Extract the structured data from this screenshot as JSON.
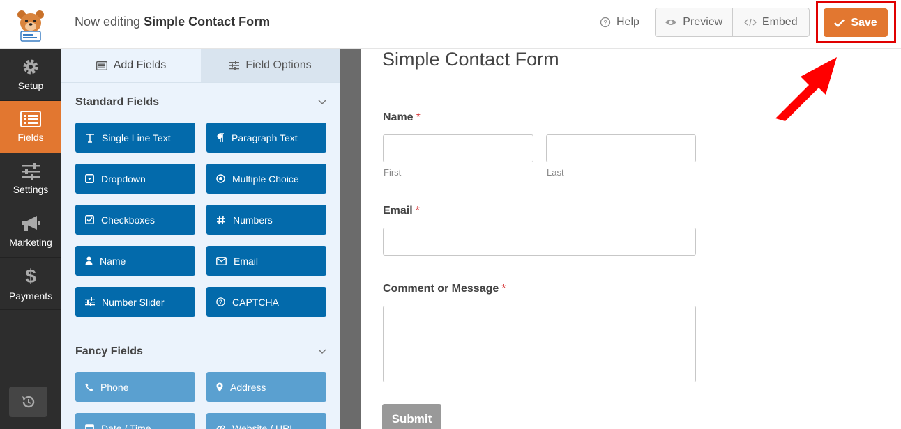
{
  "header": {
    "title_prefix": "Now editing",
    "title_form": "Simple Contact Form",
    "help_label": "Help",
    "preview_label": "Preview",
    "embed_label": "Embed",
    "save_label": "Save"
  },
  "sidebar": {
    "items": [
      {
        "label": "Setup",
        "icon": "gear-icon"
      },
      {
        "label": "Fields",
        "icon": "fields-icon"
      },
      {
        "label": "Settings",
        "icon": "sliders-icon"
      },
      {
        "label": "Marketing",
        "icon": "megaphone-icon"
      },
      {
        "label": "Payments",
        "icon": "dollar-icon"
      }
    ]
  },
  "panel": {
    "tabs": [
      {
        "label": "Add Fields"
      },
      {
        "label": "Field Options"
      }
    ],
    "standard_title": "Standard Fields",
    "standard_fields": [
      {
        "label": "Single Line Text",
        "icon": "text-icon"
      },
      {
        "label": "Paragraph Text",
        "icon": "paragraph-icon"
      },
      {
        "label": "Dropdown",
        "icon": "dropdown-icon"
      },
      {
        "label": "Multiple Choice",
        "icon": "radio-icon"
      },
      {
        "label": "Checkboxes",
        "icon": "checkbox-icon"
      },
      {
        "label": "Numbers",
        "icon": "hash-icon"
      },
      {
        "label": "Name",
        "icon": "user-icon"
      },
      {
        "label": "Email",
        "icon": "envelope-icon"
      },
      {
        "label": "Number Slider",
        "icon": "slider-icon"
      },
      {
        "label": "CAPTCHA",
        "icon": "question-icon"
      }
    ],
    "fancy_title": "Fancy Fields",
    "fancy_fields": [
      {
        "label": "Phone",
        "icon": "phone-icon"
      },
      {
        "label": "Address",
        "icon": "map-pin-icon"
      },
      {
        "label": "Date / Time",
        "icon": "calendar-icon"
      },
      {
        "label": "Website / URL",
        "icon": "link-icon"
      }
    ]
  },
  "form": {
    "title": "Simple Contact Form",
    "name_label": "Name",
    "required_mark": "*",
    "first_sublabel": "First",
    "last_sublabel": "Last",
    "email_label": "Email",
    "message_label": "Comment or Message",
    "submit_label": "Submit"
  },
  "colors": {
    "accent": "#e27730",
    "field_button": "#036aab",
    "fancy_button": "#5aa0d0",
    "highlight": "#e00000"
  }
}
